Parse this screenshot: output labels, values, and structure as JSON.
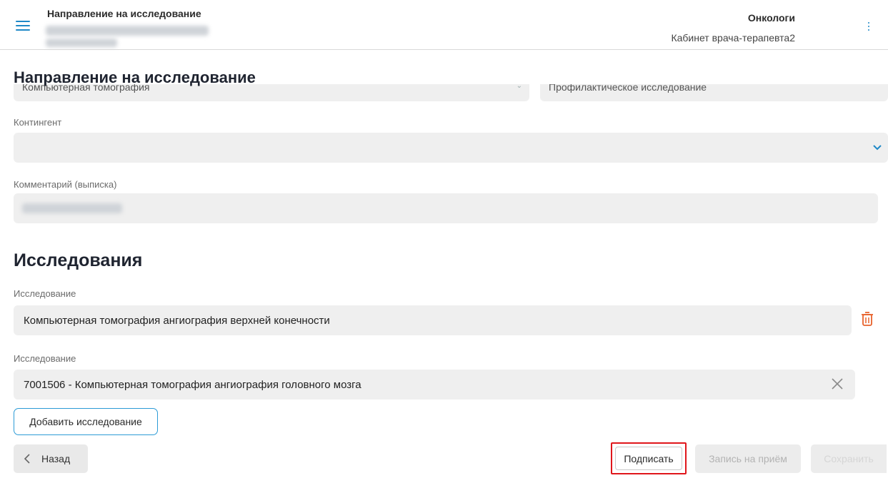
{
  "header": {
    "title": "Направление на исследование",
    "department": "Онкологи",
    "cabinet": "Кабинет врача-терапевта2"
  },
  "page": {
    "title": "Направление на исследование",
    "clipped_field_left": "Компьютерная томография",
    "clipped_field_right": "Профилактическое исследование"
  },
  "contingent": {
    "label": "Контингент",
    "value": ""
  },
  "comment": {
    "label": "Комментарий (выписка)"
  },
  "studies": {
    "title": "Исследования",
    "items": [
      {
        "label": "Исследование",
        "value": "Компьютерная томография ангиография верхней конечности"
      },
      {
        "label": "Исследование",
        "value": "7001506 - Компьютерная томография ангиография головного мозга"
      }
    ],
    "add_label": "Добавить исследование"
  },
  "footer": {
    "back_label": "Назад",
    "sign_label": "Подписать",
    "appointment_label": "Запись на приём",
    "save_label": "Сохранить"
  },
  "colors": {
    "accent": "#1e88c7",
    "highlight": "#e0161b",
    "delete": "#e8622c",
    "field_bg": "#efefef"
  },
  "icons": [
    "menu-icon",
    "more-vert-icon",
    "chevron-down-icon",
    "trash-icon",
    "close-icon",
    "chevron-left-icon"
  ]
}
